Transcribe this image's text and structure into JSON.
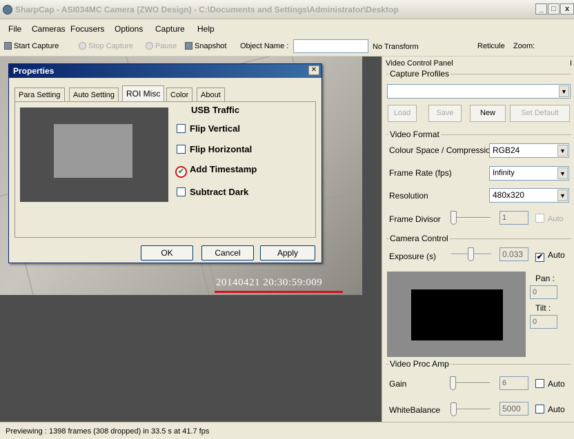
{
  "window": {
    "title": "SharpCap - ASI034MC Camera (ZWO Design) - C:\\Documents and Settings\\Administrator\\Desktop",
    "min_glyph": "_",
    "max_glyph": "□",
    "close_glyph": "x"
  },
  "menu": [
    "File",
    "Cameras",
    "Focusers",
    "Options",
    "Capture",
    "Help"
  ],
  "toolbar": {
    "start_capture": "Start Capture",
    "stop_capture": "Stop Capture",
    "pause": "Pause",
    "snapshot": "Snapshot",
    "object_name_label": "Object Name :",
    "object_name_value": "",
    "transform_value": "No Transform",
    "reticule": "Reticule",
    "zoom": "Zoom:"
  },
  "preview": {
    "timestamp": "20140421  20:30:59:009"
  },
  "dialog": {
    "title": "Properties",
    "close_glyph": "✕",
    "tabs": [
      "Para Setting",
      "Auto Setting",
      "ROI Misc",
      "Color",
      "About"
    ],
    "active_tab": "ROI Misc",
    "usb_traffic": "USB Traffic",
    "flip_vertical": {
      "label": "Flip Vertical",
      "checked": false
    },
    "flip_horizontal": {
      "label": "Flip Horizontal",
      "checked": false
    },
    "add_timestamp": {
      "label": "Add Timestamp",
      "checked": true
    },
    "subtract_dark": {
      "label": "Subtract Dark",
      "checked": false
    },
    "ok": "OK",
    "cancel": "Cancel",
    "apply": "Apply",
    "check_glyph": "✔"
  },
  "panel": {
    "title": "Video Control Panel",
    "capture_profiles": {
      "legend": "Capture Profiles",
      "selected": "",
      "load": "Load",
      "save": "Save",
      "new": "New",
      "set_default": "Set Default"
    },
    "video_format": {
      "legend": "Video Format",
      "colour_space_label": "Colour Space / Compression",
      "colour_space_value": "RGB24",
      "frame_rate_label": "Frame Rate (fps)",
      "frame_rate_value": "Infinity",
      "resolution_label": "Resolution",
      "resolution_value": "480x320",
      "frame_divisor_label": "Frame Divisor",
      "frame_divisor_value": "1",
      "frame_divisor_auto": "Auto"
    },
    "camera_control": {
      "legend": "Camera Control",
      "exposure_label": "Exposure (s)",
      "exposure_value": "0.033",
      "exposure_auto": "Auto",
      "pan_label": "Pan :",
      "pan_value": "0",
      "tilt_label": "Tilt :",
      "tilt_value": "0"
    },
    "video_proc_amp": {
      "legend": "Video Proc Amp",
      "gain_label": "Gain",
      "gain_value": "6",
      "gain_auto": "Auto",
      "wb_label": "WhiteBalance",
      "wb_value": "5000",
      "wb_auto": "Auto"
    }
  },
  "status": {
    "text": "Previewing : 1398 frames (308 dropped) in 33.5 s at 41.7 fps"
  },
  "colors": {
    "dialog_title": "#0a246a",
    "highlight_red": "#d6101c",
    "preview_bg": "#4d4d4d"
  }
}
